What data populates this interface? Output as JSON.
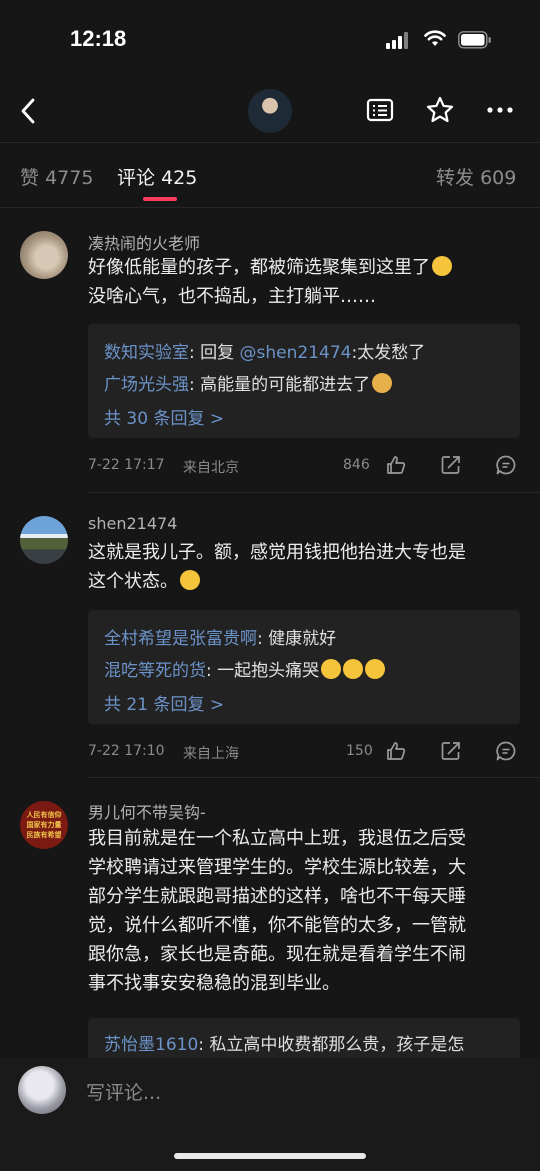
{
  "status_bar": {
    "time": "12:18"
  },
  "tabs": [
    {
      "label": "赞",
      "count": "4775"
    },
    {
      "label": "评论",
      "count": "425"
    },
    {
      "label": "转发",
      "count": "609"
    }
  ],
  "comments": [
    {
      "name": "凑热闹的火老师",
      "lines": [
        "好像低能量的孩子，都被筛选聚集到这里了",
        "没啥心气，也不捣乱，主打躺平……"
      ],
      "replies": [
        {
          "user": "数知实验室",
          "pre": ": 回复 ",
          "mention": "@shen21474",
          "text": ":太发愁了"
        },
        {
          "user": "广场光头强",
          "pre": ": 高能量的可能都进去了",
          "mention": "",
          "text": ""
        }
      ],
      "more": "共 30 条回复 >",
      "time": "7-22 17:17",
      "location": "来自北京",
      "likes": "846"
    },
    {
      "name": "shen21474",
      "lines": [
        "这就是我儿子。额，感觉用钱把他抬进大专也是",
        "这个状态。"
      ],
      "replies": [
        {
          "user": "全村希望是张富贵啊",
          "pre": ": 健康就好",
          "mention": "",
          "text": ""
        },
        {
          "user": "混吃等死的货",
          "pre": ": 一起抱头痛哭",
          "mention": "",
          "text": ""
        }
      ],
      "more": "共 21 条回复 >",
      "time": "7-22 17:10",
      "location": "来自上海",
      "likes": "150"
    },
    {
      "name": "男儿何不带吴钩-",
      "lines": [
        "我目前就是在一个私立高中上班，我退伍之后受",
        "学校聘请过来管理学生的。学校生源比较差，大",
        "部分学生就跟跑哥描述的这样，啥也不干每天睡",
        "觉，说什么都听不懂，你不能管的太多，一管就",
        "跟你急，家长也是奇葩。现在就是看着学生不闹",
        "事不找事安安稳稳的混到毕业。"
      ],
      "replies": [
        {
          "user": "苏怡墨1610",
          "pre": ": 私立高中收费都那么贵，孩子是怎",
          "mention": "",
          "text": ""
        }
      ]
    }
  ],
  "avatar_badge_text": "人民有信仰 国家有力量 民族有希望",
  "comment_input": {
    "placeholder": "写评论..."
  },
  "colors": {
    "accent": "#ff3b5c",
    "link": "#6c93c9",
    "background": "#161616"
  },
  "icons": [
    "back-icon",
    "list-icon",
    "star-icon",
    "more-icon",
    "like-icon",
    "share-icon",
    "comment-icon"
  ]
}
